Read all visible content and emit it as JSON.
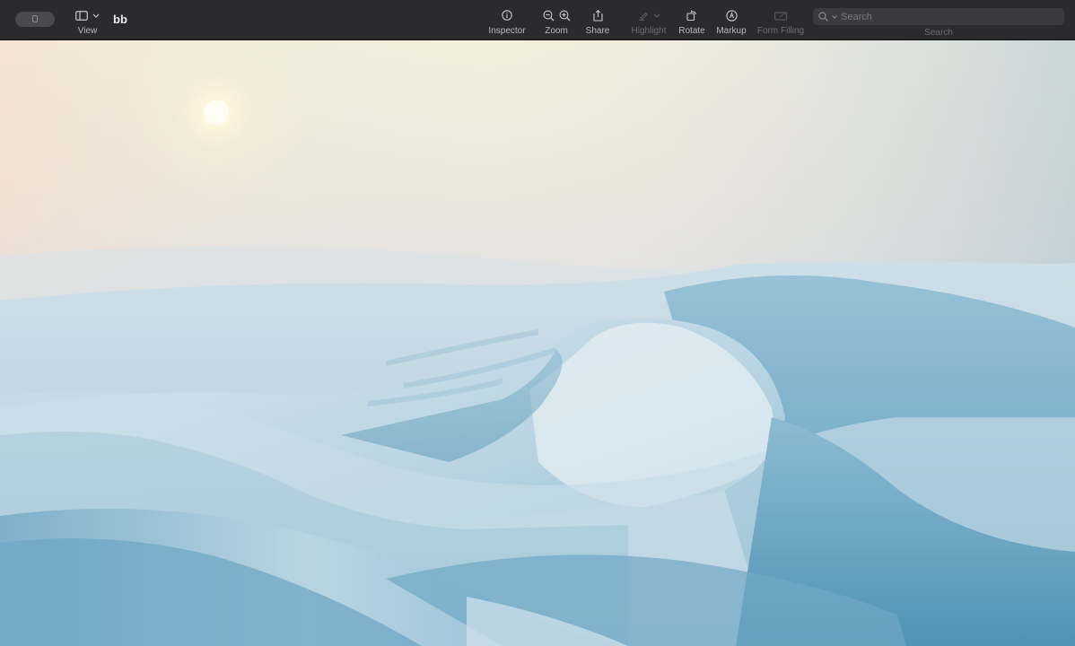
{
  "window": {
    "title": "bb"
  },
  "toolbar": {
    "view_label": "View",
    "inspector_label": "Inspector",
    "zoom_label": "Zoom",
    "share_label": "Share",
    "highlight_label": "Highlight",
    "rotate_label": "Rotate",
    "markup_label": "Markup",
    "form_filling_label": "Form Filling",
    "search_label": "Search",
    "search_placeholder": "Search"
  },
  "icons": {
    "sidebar": "sidebar-icon",
    "chevron": "chevron-down-icon",
    "info": "info-icon",
    "zoom_out": "zoom-out-icon",
    "zoom_in": "zoom-in-icon",
    "share": "share-icon",
    "highlight": "highlighter-icon",
    "rotate": "rotate-icon",
    "markup": "markup-pen-icon",
    "form": "form-filling-icon",
    "search": "search-icon"
  },
  "colors": {
    "toolbar_bg": "#2b2b2d",
    "sky_top": "#f3efde",
    "dune_blue": "#5f9cbb"
  }
}
